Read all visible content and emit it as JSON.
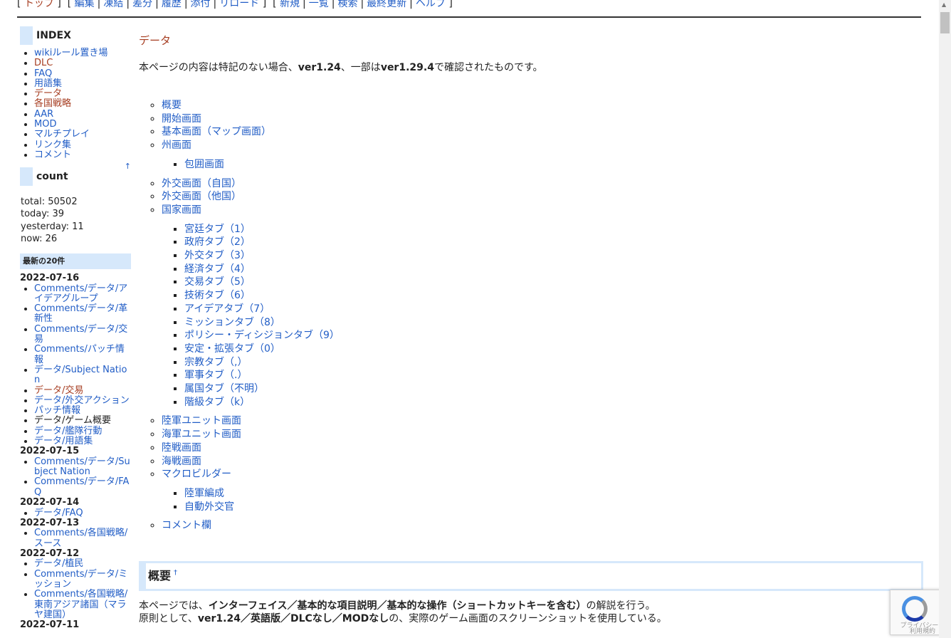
{
  "nav": {
    "open1": "[",
    "top": "トップ",
    "close1": "]",
    "open2": "[",
    "edit": "編集",
    "freeze": "凍結",
    "diff": "差分",
    "history": "履歴",
    "attach": "添付",
    "reload": "リロード",
    "close2": "]",
    "open3": "[",
    "new": "新規",
    "list": "一覧",
    "search": "検索",
    "recent": "最終更新",
    "help": "ヘルプ",
    "close3": "]",
    "sep": "|"
  },
  "sidebar": {
    "index_title": "INDEX",
    "index_items": [
      "wikiルール置き場",
      "DLC",
      "FAQ",
      "用語集",
      "データ",
      "各国戦略",
      "AAR",
      "MOD",
      "マルチプレイ",
      "リンク集",
      "コメント"
    ],
    "up_arrow": "↑",
    "count_title": "count",
    "count": {
      "total": "total: 50502",
      "today": "today: 39",
      "yesterday": "yesterday: 11",
      "now": "now: 26"
    },
    "recent_title": "最新の20件",
    "recent": [
      {
        "date": "2022-07-16",
        "items": [
          "Comments/データ/アイデアグループ",
          "Comments/データ/革新性",
          "Comments/データ/交易",
          "Comments/パッチ情報",
          "データ/Subject Nation",
          "データ/交易",
          "データ/外交アクション",
          "パッチ情報",
          "データ/ゲーム概要",
          "データ/艦隊行動",
          "データ/用語集"
        ]
      },
      {
        "date": "2022-07-15",
        "items": [
          "Comments/データ/Subject Nation",
          "Comments/データ/FAQ"
        ]
      },
      {
        "date": "2022-07-14",
        "items": [
          "データ/FAQ"
        ]
      },
      {
        "date": "2022-07-13",
        "items": [
          "Comments/各国戦略/スース"
        ]
      },
      {
        "date": "2022-07-12",
        "items": [
          "データ/植民",
          "Comments/データ/ミッション",
          "Comments/各国戦略/東南アジア諸国（マラヤ建国）"
        ]
      },
      {
        "date": "2022-07-11",
        "items": []
      }
    ]
  },
  "main": {
    "title": "データ",
    "intro_a": "本ページの内容は特記のない場合、",
    "intro_b": "ver1.24",
    "intro_c": "、一部は",
    "intro_d": "ver1.29.4",
    "intro_e": "で確認されたものです。",
    "toc": {
      "t1": "概要",
      "t2": "開始画面",
      "t3": "基本画面（マップ画面）",
      "t4": "州画面",
      "t4a": "包囲画面",
      "t5": "外交画面（自国）",
      "t6": "外交画面（他国）",
      "t7": "国家画面",
      "t7items": [
        "宮廷タブ（1）",
        "政府タブ（2）",
        "外交タブ（3）",
        "経済タブ（4）",
        "交易タブ（5）",
        "技術タブ（6）",
        "アイデアタブ（7）",
        "ミッションタブ（8）",
        "ポリシー・ディシジョンタブ（9）",
        "安定・拡張タブ（0）",
        "宗教タブ（,）",
        "軍事タブ（.）",
        "属国タブ（不明）",
        "階級タブ（k）"
      ],
      "t8": "陸軍ユニット画面",
      "t9": "海軍ユニット画面",
      "t10": "陸戦画面",
      "t11": "海戦画面",
      "t12": "マクロビルダー",
      "t12a": "陸軍編成",
      "t12b": "自動外交官",
      "t13": "コメント欄"
    },
    "section_title": "概要",
    "section_anchor": "†",
    "p1_a": "本ページでは、",
    "p1_b": "インターフェイス／基本的な項目説明／基本的な操作（ショートカットキーを含む）",
    "p1_c": "の解説を行う。",
    "p2_a": "原則として、",
    "p2_b": "ver1.24／英語版／DLCなし／MODなし",
    "p2_c": "の、実際のゲーム画面のスクリーンショットを使用している。"
  },
  "recaptcha": {
    "privacy": "プライバシー・",
    "terms": "利用規約"
  },
  "colors": {
    "link": "#215dc6",
    "visited": "#a63d21",
    "accent_bg": "#d6e8fb"
  }
}
